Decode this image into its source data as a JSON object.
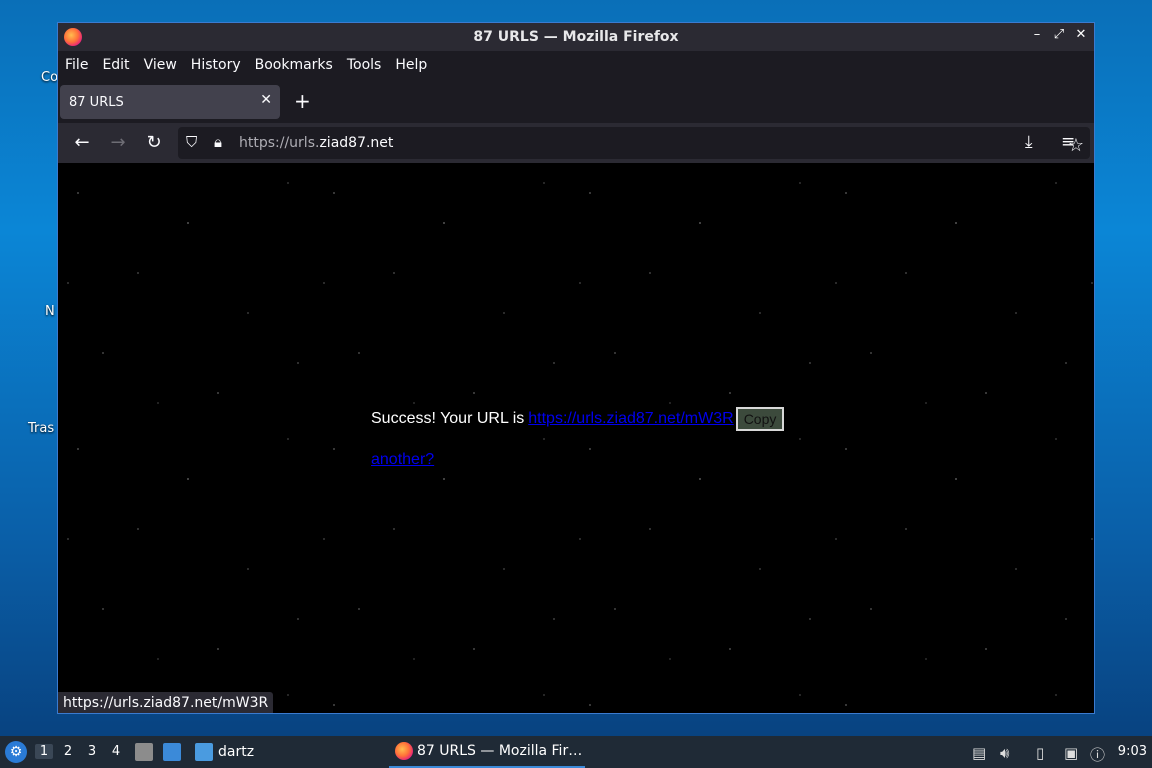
{
  "desktop": {
    "icon_label_fragments": [
      "Co",
      "N",
      "Tras"
    ]
  },
  "window": {
    "title": "87 URLS — Mozilla Firefox",
    "controls": [
      "–",
      "⤢",
      "✕"
    ]
  },
  "menu": [
    "File",
    "Edit",
    "View",
    "History",
    "Bookmarks",
    "Tools",
    "Help"
  ],
  "tabs": [
    {
      "title": "87 URLS",
      "active": true
    }
  ],
  "navbar": {
    "url_prefix": "https://urls.",
    "url_host": "ziad87.net",
    "icons": [
      "back-icon",
      "forward-icon",
      "reload-icon",
      "shield-icon",
      "lock-icon",
      "star-icon",
      "download-icon",
      "menu-icon"
    ]
  },
  "page": {
    "success_text": "Success! Your URL is",
    "short_url": "https://urls.ziad87.net/mW3R",
    "copy_label": "Copy",
    "another_label": "another?"
  },
  "status_bar": {
    "hover_url": "https://urls.ziad87.net/mW3R"
  },
  "taskbar": {
    "workspaces": [
      "1",
      "2",
      "3",
      "4"
    ],
    "active_workspace": "1",
    "folder_label": "dartz",
    "task_label": "87 URLS — Mozilla Fir…",
    "clock": "9:03"
  }
}
